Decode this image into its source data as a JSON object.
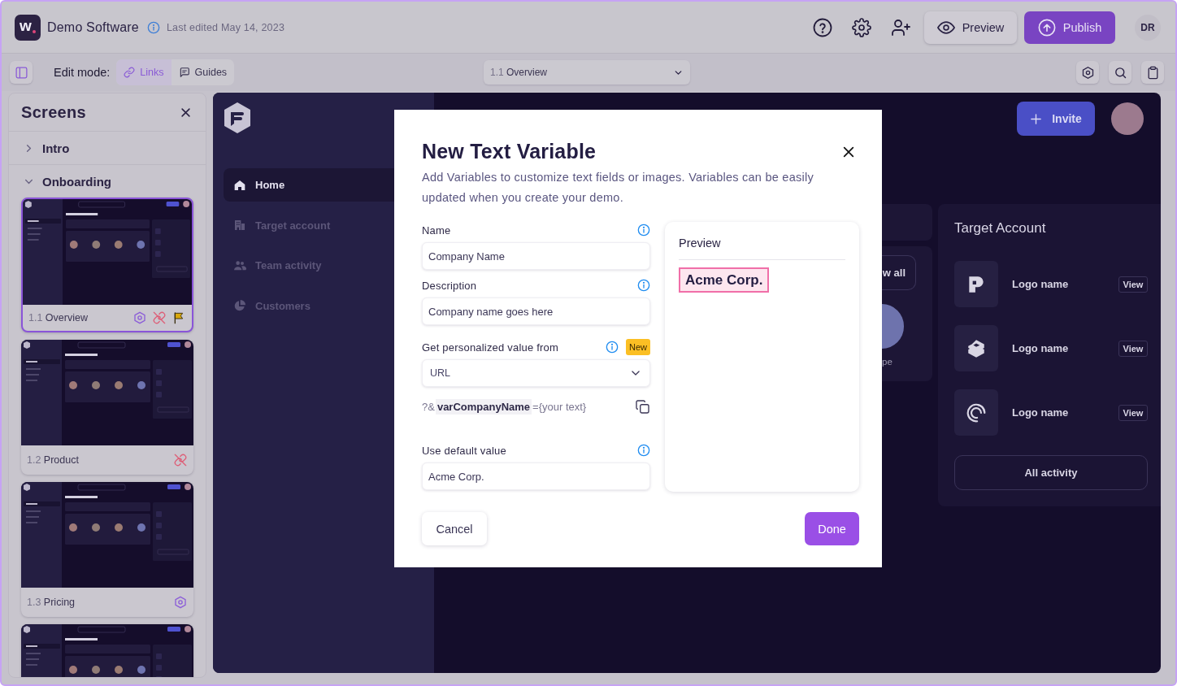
{
  "header": {
    "logo": "w",
    "title": "Demo Software",
    "last_edited": "Last edited May 14, 2023",
    "preview_button": "Preview",
    "publish_button": "Publish",
    "user_initials": "DR"
  },
  "toolbar": {
    "edit_mode_label": "Edit mode:",
    "modes": [
      {
        "kind": "link",
        "label": "Links",
        "selected": true
      },
      {
        "kind": "guide",
        "label": "Guides",
        "selected": false
      }
    ],
    "screen_select": {
      "number": "1.1",
      "name": "Overview"
    }
  },
  "screens_panel": {
    "title": "Screens",
    "groups": [
      {
        "label": "Intro",
        "expanded": false
      },
      {
        "label": "Onboarding",
        "expanded": true,
        "screens": [
          {
            "number": "1.1",
            "name": "Overview",
            "selected": true,
            "markers": [
              {
                "kind": "hexagon"
              },
              {
                "kind": "broken-link"
              },
              {
                "kind": "flag"
              }
            ]
          },
          {
            "number": "1.2",
            "name": "Product",
            "selected": false,
            "markers": [
              {
                "kind": "broken-link"
              }
            ]
          },
          {
            "number": "1.3",
            "name": "Pricing",
            "selected": false,
            "markers": [
              {
                "kind": "hexagon"
              }
            ]
          },
          {
            "selected": false
          }
        ]
      }
    ]
  },
  "demo": {
    "nav": [
      {
        "kind": "home",
        "label": "Home",
        "selected": true
      },
      {
        "kind": "building",
        "label": "Target account",
        "selected": false
      },
      {
        "kind": "team",
        "label": "Team activity",
        "selected": false
      },
      {
        "kind": "pie",
        "label": "Customers",
        "selected": false
      }
    ],
    "invite_button": "Invite",
    "view_all_button": "w all",
    "member_name": "pe",
    "target_account": {
      "title": "Target Account",
      "rows": [
        {
          "kind": "p",
          "name": "Logo name",
          "button": "View"
        },
        {
          "kind": "layers",
          "name": "Logo name",
          "button": "View"
        },
        {
          "kind": "rings",
          "name": "Logo name",
          "button": "View"
        }
      ],
      "all_activity_button": "All activity"
    }
  },
  "dialog": {
    "title": "New Text Variable",
    "description": "Add Variables to customize text fields or images. Variables can be easily updated when you create your demo.",
    "fields": [
      {
        "kind": "input",
        "label": "Name",
        "value": "Company Name"
      },
      {
        "kind": "input",
        "label": "Description",
        "value": "Company name goes here"
      },
      {
        "kind": "select",
        "label": "Get personalized value from",
        "badge": "New",
        "value": "URL"
      },
      {
        "kind": "param",
        "prefix": "?&",
        "name": "varCompanyName",
        "suffix": "={your text}"
      },
      {
        "kind": "input",
        "label": "Use default value",
        "value": "Acme Corp."
      }
    ],
    "preview": {
      "title": "Preview",
      "text": "Acme Corp."
    },
    "cancel_button": "Cancel",
    "done_button": "Done"
  }
}
